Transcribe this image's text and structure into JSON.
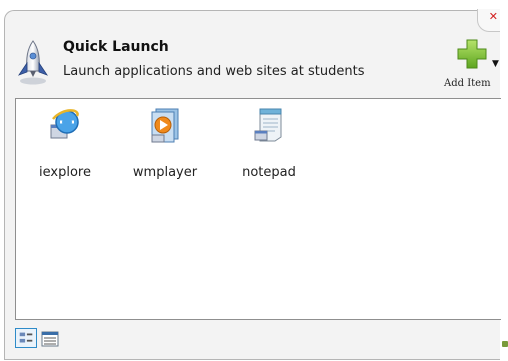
{
  "window": {
    "title": "Quick Launch",
    "subtitle": "Launch applications and web sites at students"
  },
  "toolbar": {
    "add_item_label": "Add Item"
  },
  "apps": [
    {
      "name": "iexplore",
      "icon": "internet-explorer-icon"
    },
    {
      "name": "wmplayer",
      "icon": "media-player-icon"
    },
    {
      "name": "notepad",
      "icon": "notepad-icon"
    }
  ],
  "view_modes": [
    "icons-view",
    "details-view"
  ],
  "colors": {
    "panel_bg": "#f3f3f3",
    "list_bg": "#ffffff",
    "add_green": "#7dc131",
    "selected_view_border": "#2e8bc8"
  }
}
